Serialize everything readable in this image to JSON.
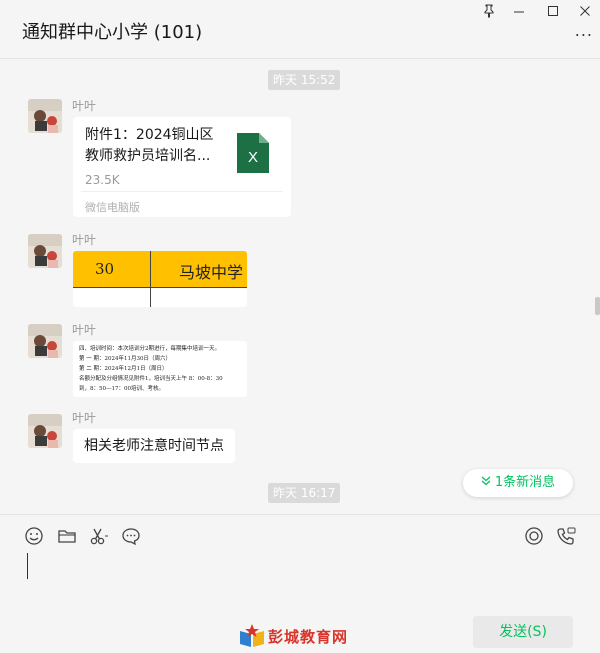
{
  "window": {
    "title": "通知群中心小学 (101)",
    "controls": [
      "pin-icon",
      "minimize-icon",
      "maximize-icon",
      "close-icon"
    ],
    "more_label": "..."
  },
  "chat": {
    "timestamps": [
      "昨天 15:52",
      "昨天 16:17"
    ],
    "messages": [
      {
        "sender": "叶叶",
        "type": "file",
        "file_name": "附件1：2024铜山区教师救护员培训名...",
        "file_size": "23.5K",
        "source": "微信电脑版",
        "file_icon": "excel-icon",
        "file_icon_letter": "X"
      },
      {
        "sender": "叶叶",
        "type": "image",
        "image_texts": [
          "30",
          "马坡中学"
        ]
      },
      {
        "sender": "叶叶",
        "type": "image",
        "image_lines": [
          "四、培训时间：本次培训分2期进行，每期集中培训一天。",
          "第 一 期：2024年11月30日（周六）",
          "第 二 期：2024年12月1日（周日）",
          "名额分配及分组情况见附件1，培训当天上午 8：00-8：30",
          "到，8：50—17：00培训、考核。"
        ]
      },
      {
        "sender": "叶叶",
        "type": "text",
        "text": "相关老师注意时间节点"
      }
    ],
    "new_messages_label": "1条新消息"
  },
  "composer": {
    "tools": [
      "emoji-icon",
      "folder-icon",
      "scissors-icon",
      "chat-bubble-icon"
    ],
    "right_tools": [
      "live-icon",
      "voice-call-icon"
    ],
    "send_label": "发送(S)"
  },
  "watermark": {
    "text": "彭城教育网"
  },
  "colors": {
    "accent_green": "#07c160",
    "excel_green": "#1d7044",
    "table_yellow": "#ffc000"
  }
}
